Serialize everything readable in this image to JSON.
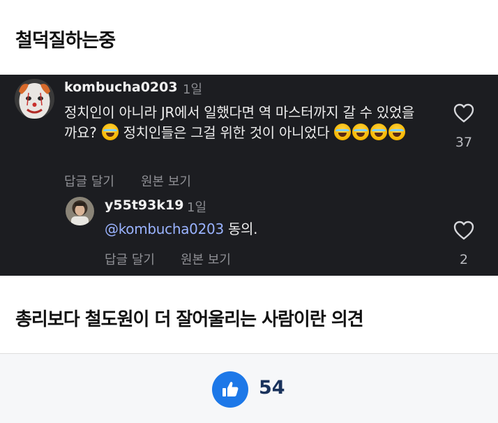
{
  "post": {
    "title": "철덕질하는중",
    "caption": "총리보다 철도원이 더 잘어울리는 사람이란 의견"
  },
  "comments": [
    {
      "username": "kombucha0203",
      "time": "1일",
      "text_a": "정치인이 아니라 JR에서 일했다면 역 마스터까지 갈 수 있었을까요? ",
      "text_b": " 정치인들은 그걸 위한 것이 아니었다 ",
      "reply_label": "답글 달기",
      "original_label": "원본 보기",
      "likes": "37",
      "avatar_icon": "clown-avatar"
    },
    {
      "username": "y55t93k19",
      "time": "1일",
      "mention": "@kombucha0203",
      "text": " 동의.",
      "reply_label": "답글 달기",
      "original_label": "원본 보기",
      "likes": "2",
      "avatar_icon": "user-photo-avatar"
    }
  ],
  "footer": {
    "like_count": "54",
    "like_icon": "thumbs-up-icon"
  },
  "colors": {
    "comment_bg": "#1c1d21",
    "mention": "#9ab3ff",
    "like_button": "#1d78e8",
    "like_count": "#19325c"
  }
}
